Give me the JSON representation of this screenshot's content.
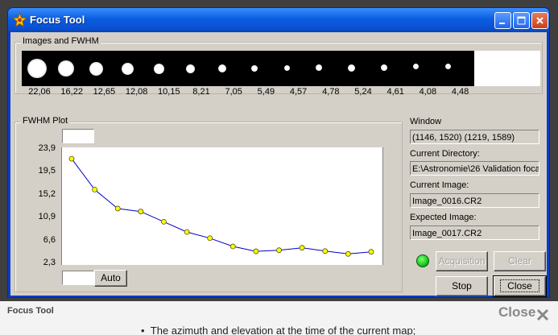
{
  "window": {
    "title": "Focus Tool",
    "icon": "star-gear-icon"
  },
  "images_group": {
    "label": "Images and FWHM",
    "fwhm_values": [
      "22,06",
      "16,22",
      "12,65",
      "12,08",
      "10,15",
      "8,21",
      "7,05",
      "5,49",
      "4,57",
      "4,78",
      "5,24",
      "4,61",
      "4,08",
      "4,48"
    ]
  },
  "plot_group": {
    "label": "FWHM Plot",
    "top_input": "",
    "bottom_input": "",
    "auto_button": "Auto"
  },
  "chart_data": {
    "type": "line",
    "title": "FWHM Plot",
    "y_ticks": [
      "23,9",
      "19,5",
      "15,2",
      "10,9",
      "6,6",
      "2,3"
    ],
    "ylim": [
      2.3,
      23.9
    ],
    "x": [
      1,
      2,
      3,
      4,
      5,
      6,
      7,
      8,
      9,
      10,
      11,
      12,
      13,
      14
    ],
    "values": [
      22.06,
      16.22,
      12.65,
      12.08,
      10.15,
      8.21,
      7.05,
      5.49,
      4.57,
      4.78,
      5.24,
      4.61,
      4.08,
      4.48
    ],
    "line_color": "#0000cc",
    "marker_color": "#ffff00",
    "grid": false
  },
  "details": {
    "window_label": "Window",
    "window_value": "(1146, 1520)  (1219, 1589)",
    "current_directory_label": "Current Directory:",
    "current_directory_value": "E:\\Astronomie\\26 Validation foca",
    "current_image_label": "Current Image:",
    "current_image_value": "Image_0016.CR2",
    "expected_image_label": "Expected Image:",
    "expected_image_value": "Image_0017.CR2"
  },
  "buttons": {
    "acquisition": "Acquisition",
    "clear": "Clear",
    "stop": "Stop",
    "close": "Close"
  },
  "status": {
    "led_color": "#18c818"
  },
  "footer": {
    "title": "Focus Tool",
    "close_label": "Close",
    "page_text": "The azimuth and elevation at the time of the current map;"
  }
}
